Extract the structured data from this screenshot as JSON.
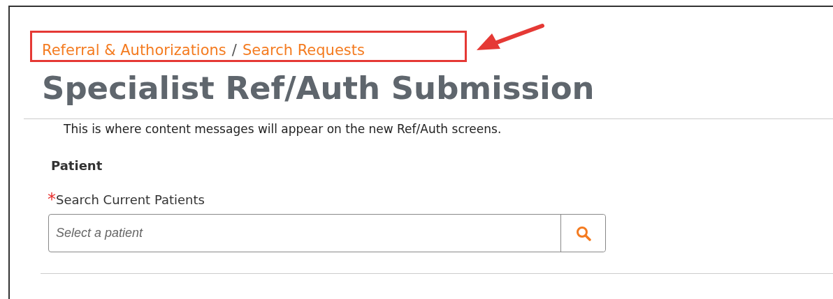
{
  "breadcrumb": [
    {
      "label": "Referral & Authorizations"
    },
    {
      "label": "Search Requests"
    }
  ],
  "breadcrumb_separator": "/",
  "title": "Specialist Ref/Auth Submission",
  "message": "This is where content messages will appear on the new Ref/Auth screens.",
  "section": "Patient",
  "field": {
    "label": "Search Current Patients",
    "required": true,
    "required_mark": "*",
    "placeholder": "Select a patient"
  }
}
